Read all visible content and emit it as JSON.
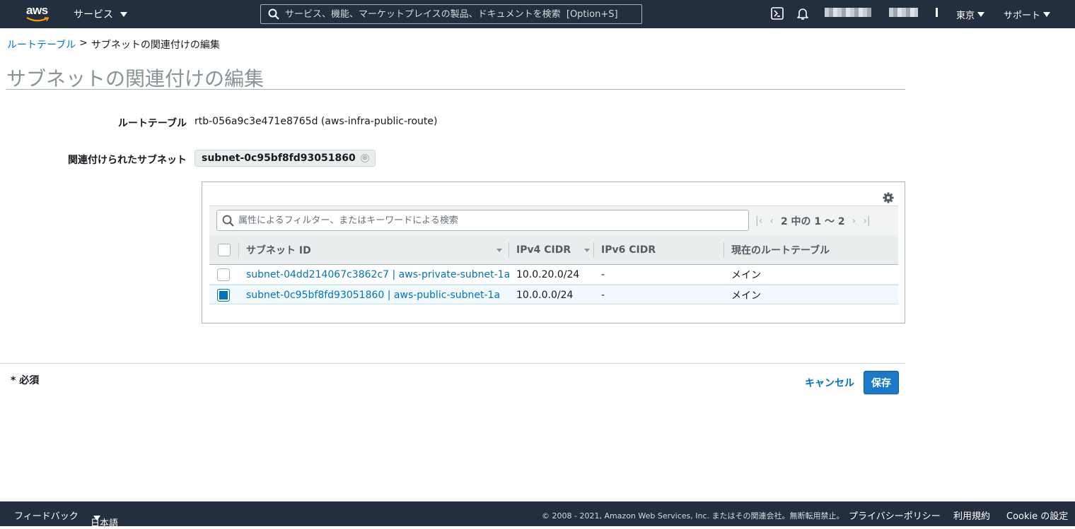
{
  "topnav": {
    "logo_text": "aws",
    "services_label": "サービス",
    "search_placeholder": "サービス、機能、マーケットプレイスの製品、ドキュメントを検索  [Option+S]",
    "region_label": "東京",
    "support_label": "サポート"
  },
  "breadcrumb": {
    "parent": "ルートテーブル",
    "separator": ">",
    "current": "サブネットの関連付けの編集"
  },
  "page_title": "サブネットの関連付けの編集",
  "form": {
    "route_table_label": "ルートテーブル",
    "route_table_value": "rtb-056a9c3e471e8765d (aws-infra-public-route)",
    "associated_subnets_label": "関連付けられたサブネット",
    "token_value": "subnet-0c95bf8fd93051860",
    "token_remove": "⊗"
  },
  "table": {
    "filter_placeholder": "属性によるフィルター、またはキーワードによる検索",
    "pagination": "2 中の 1 〜 2",
    "columns": [
      "サブネット ID",
      "IPv4 CIDR",
      "IPv6 CIDR",
      "現在のルートテーブル"
    ],
    "rows": [
      {
        "subnet": "subnet-04dd214067c3862c7 | aws-private-subnet-1a",
        "ipv4": "10.0.20.0/24",
        "ipv6": "-",
        "route_table": "メイン",
        "checked": false
      },
      {
        "subnet": "subnet-0c95bf8fd93051860 | aws-public-subnet-1a",
        "ipv4": "10.0.0.0/24",
        "ipv6": "-",
        "route_table": "メイン",
        "checked": true
      }
    ]
  },
  "footer": {
    "required": "* 必須",
    "cancel_label": "キャンセル",
    "save_label": "保存"
  },
  "bottombar": {
    "feedback": "フィードバック",
    "language": "日本語",
    "copyright": "© 2008 - 2021, Amazon Web Services, Inc. またはその関連会社。無断転用禁止。",
    "privacy": "プライバシーポリシー",
    "terms": "利用規約",
    "cookie": "Cookie の設定"
  },
  "colors": {
    "nav_bg": "#232f3e",
    "link": "#0073bb",
    "primary_button": "#1a79c8"
  }
}
